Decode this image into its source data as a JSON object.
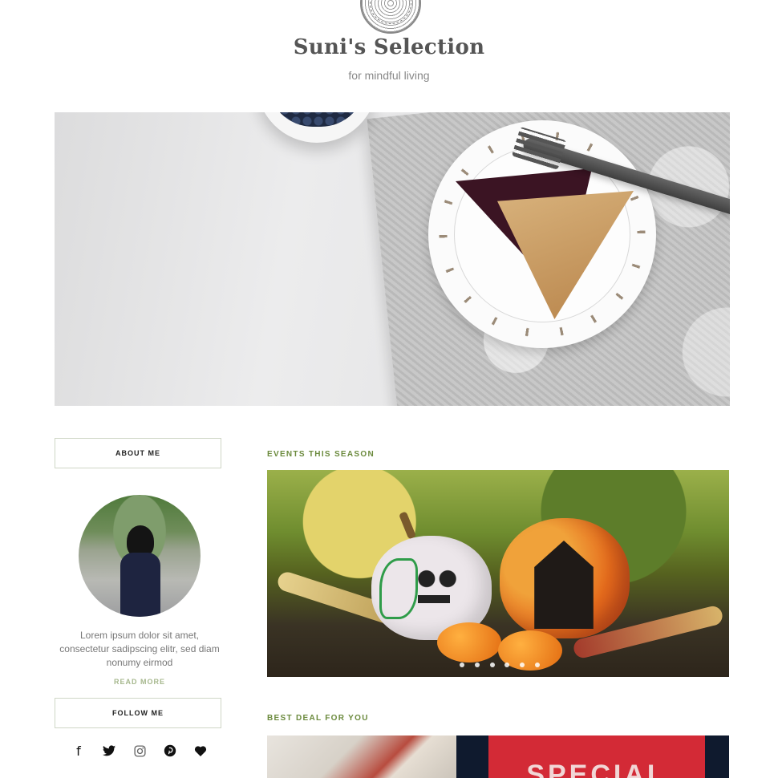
{
  "header": {
    "title": "Suni's Selection",
    "tagline": "for mindful living"
  },
  "sidebar": {
    "about_label": "About Me",
    "about_text": "Lorem ipsum dolor sit amet, consectetur sadipscing elitr, sed diam nonumy eirmod",
    "read_more_label": "Read More",
    "follow_label": "Follow Me",
    "social_icons": [
      "facebook-icon",
      "twitter-icon",
      "instagram-icon",
      "pinterest-icon",
      "heart-icon"
    ]
  },
  "main": {
    "events_label": "Events This Season",
    "deal_label": "Best Deal For You",
    "deal_banner_text": "SPECIAL"
  },
  "colors": {
    "accent_green": "#6b8a3d",
    "read_more_green": "#a7b88e",
    "box_border": "#cfd6c6",
    "deal_red": "#d32a36"
  }
}
